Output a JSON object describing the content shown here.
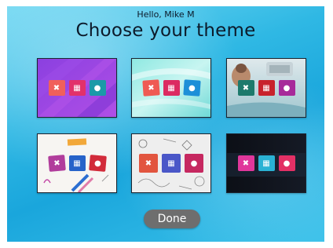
{
  "header": {
    "greeting": "Hello, Mike M",
    "title": "Choose your theme"
  },
  "themes": [
    {
      "style": "purple",
      "icon_colors": [
        "#f0605b",
        "#e2316a",
        "#1b9aa8"
      ]
    },
    {
      "style": "aqua",
      "icon_colors": [
        "#ef5a54",
        "#dc2b61",
        "#1d8fd8"
      ]
    },
    {
      "style": "illustrated",
      "icon_colors": [
        "#1d7a6c",
        "#c8222c",
        "#a72a9a"
      ]
    },
    {
      "style": "sketch",
      "icon_colors": [
        "#b13d9c",
        "#2763c9",
        "#d22b3a"
      ]
    },
    {
      "style": "doodle",
      "icon_colors": [
        "#e2553f",
        "#4a57c8",
        "#c62860"
      ]
    },
    {
      "style": "dark",
      "icon_colors": [
        "#e0379b",
        "#2ab2d4",
        "#e33065"
      ]
    }
  ],
  "icons": [
    "tools-icon",
    "calendar-icon",
    "location-pin-icon"
  ],
  "done_label": "Done"
}
